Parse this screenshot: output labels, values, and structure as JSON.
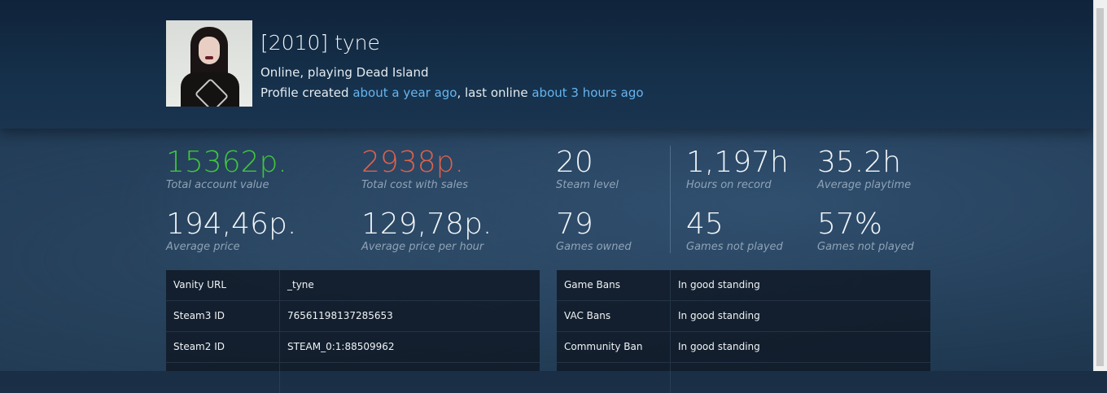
{
  "profile": {
    "name": "[2010] tyne",
    "status": "Online, playing Dead Island",
    "created_prefix": "Profile created ",
    "created_ago": "about a year ago",
    "last_online_prefix": ", last online ",
    "last_online_ago": "about 3 hours ago"
  },
  "stats": [
    {
      "value": "15362p.",
      "label": "Total account value",
      "color": "#3fc63a"
    },
    {
      "value": "2938p.",
      "label": "Total cost with sales",
      "color": "#e0604b"
    },
    {
      "value": "20",
      "label": "Steam level",
      "color": "#f2f6f9"
    },
    {
      "value": "1,197h",
      "label": "Hours on record",
      "color": "#f2f6f9"
    },
    {
      "value": "35.2h",
      "label": "Average playtime",
      "color": "#f2f6f9"
    },
    {
      "value": "194,46p.",
      "label": "Average price",
      "color": "#f2f6f9"
    },
    {
      "value": "129,78p.",
      "label": "Average price per hour",
      "color": "#f2f6f9"
    },
    {
      "value": "79",
      "label": "Games owned",
      "color": "#f2f6f9"
    },
    {
      "value": "45",
      "label": "Games not played",
      "color": "#f2f6f9"
    },
    {
      "value": "57%",
      "label": "Games not played",
      "color": "#f2f6f9"
    }
  ],
  "ids_table": [
    {
      "key": "Vanity URL",
      "value": "_tyne"
    },
    {
      "key": "Steam3 ID",
      "value": "76561198137285653"
    },
    {
      "key": "Steam2 ID",
      "value": "STEAM_0:1:88509962"
    }
  ],
  "bans_table": [
    {
      "key": "Game Bans",
      "value": "In good standing"
    },
    {
      "key": "VAC Bans",
      "value": "In good standing"
    },
    {
      "key": "Community Ban",
      "value": "In good standing"
    }
  ]
}
